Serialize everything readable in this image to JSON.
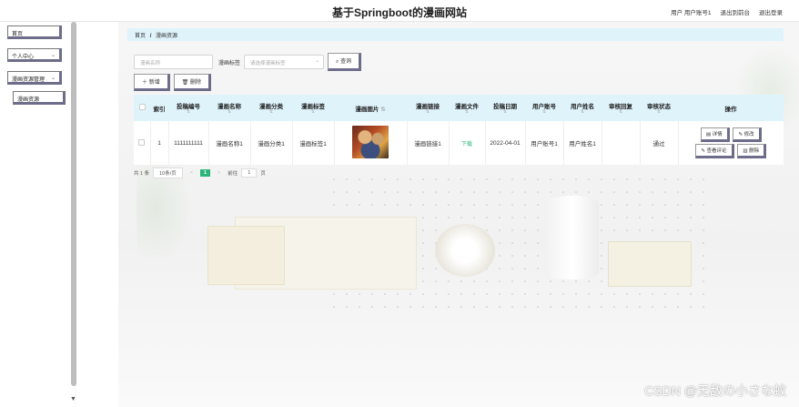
{
  "header": {
    "title": "基于Springboot的漫画网站",
    "user_label": "用户 用户账号1",
    "back_label": "退出到前台",
    "logout_label": "退出登录"
  },
  "sidebar": {
    "items": [
      {
        "label": "首页"
      },
      {
        "label": "个人中心",
        "chevron": "chevron-down-icon"
      },
      {
        "label": "漫画资源管理",
        "chevron": "chevron-down-icon"
      },
      {
        "label": "漫画资源"
      }
    ]
  },
  "breadcrumb": {
    "home": "首页",
    "separator": "/",
    "current": "漫画资源"
  },
  "search": {
    "name_placeholder": "漫画名称",
    "tag_label": "漫画标签",
    "tag_placeholder": "请选择漫画标签",
    "search_label": "查询"
  },
  "actions": {
    "add_label": "新增",
    "delete_label": "删除"
  },
  "table": {
    "columns": [
      "索引",
      "投稿编号",
      "漫画名称",
      "漫画分类",
      "漫画标签",
      "漫画图片",
      "漫画链接",
      "漫画文件",
      "投稿日期",
      "用户账号",
      "用户姓名",
      "审核回复",
      "审核状态",
      "操作"
    ],
    "rows": [
      {
        "index": "1",
        "code": "1111111111",
        "name": "漫画名称1",
        "category": "漫画分类1",
        "tag": "漫画标签1",
        "link": "漫画链接1",
        "file": "下载",
        "date": "2022-04-01",
        "account": "用户账号1",
        "username": "用户姓名1",
        "reply": "",
        "status": "通过",
        "ops": [
          "详情",
          "修改",
          "查看评论",
          "删除"
        ]
      }
    ]
  },
  "pagination": {
    "total": "共 1 条",
    "page_size": "10条/页",
    "prev": "<",
    "current": "1",
    "next": ">",
    "goto_prefix": "前往",
    "goto_value": "1",
    "goto_suffix": "页"
  },
  "watermark": "CSDN @无敌の小さな蚊",
  "colors": {
    "accent": "#2cb57a",
    "header_bg": "#dff3fb"
  }
}
